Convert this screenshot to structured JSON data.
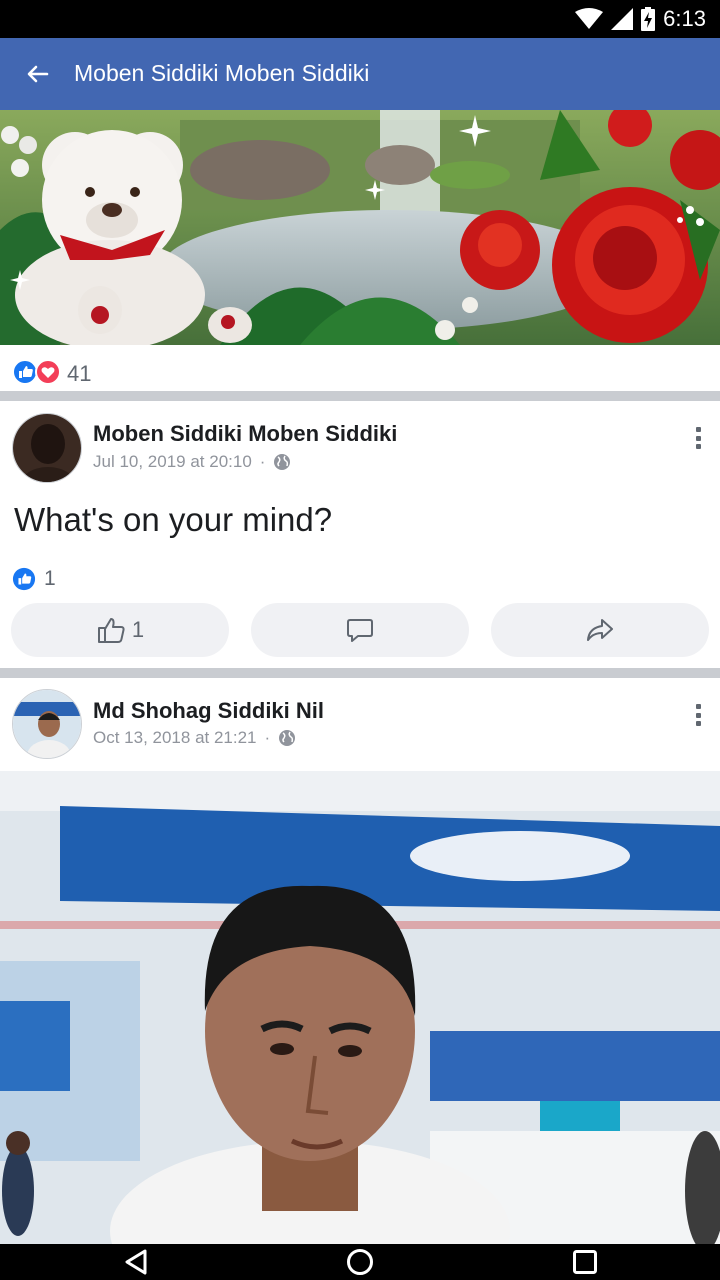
{
  "status_bar": {
    "time": "6:13"
  },
  "app_bar": {
    "title": "Moben Siddiki Moben Siddiki"
  },
  "cover": {
    "reaction_count": "41"
  },
  "posts": [
    {
      "author": "Moben Siddiki Moben Siddiki",
      "timestamp": "Jul 10, 2019 at 20:10",
      "separator": "·",
      "text": "What's on your mind?",
      "like_count": "1",
      "like_button_count": "1"
    },
    {
      "author": "Md Shohag Siddiki Nil",
      "timestamp": "Oct 13, 2018 at 21:21",
      "separator": "·"
    }
  ],
  "colors": {
    "brand": "#4267b2",
    "like_blue": "#1877f2",
    "love_red": "#f33e58"
  }
}
